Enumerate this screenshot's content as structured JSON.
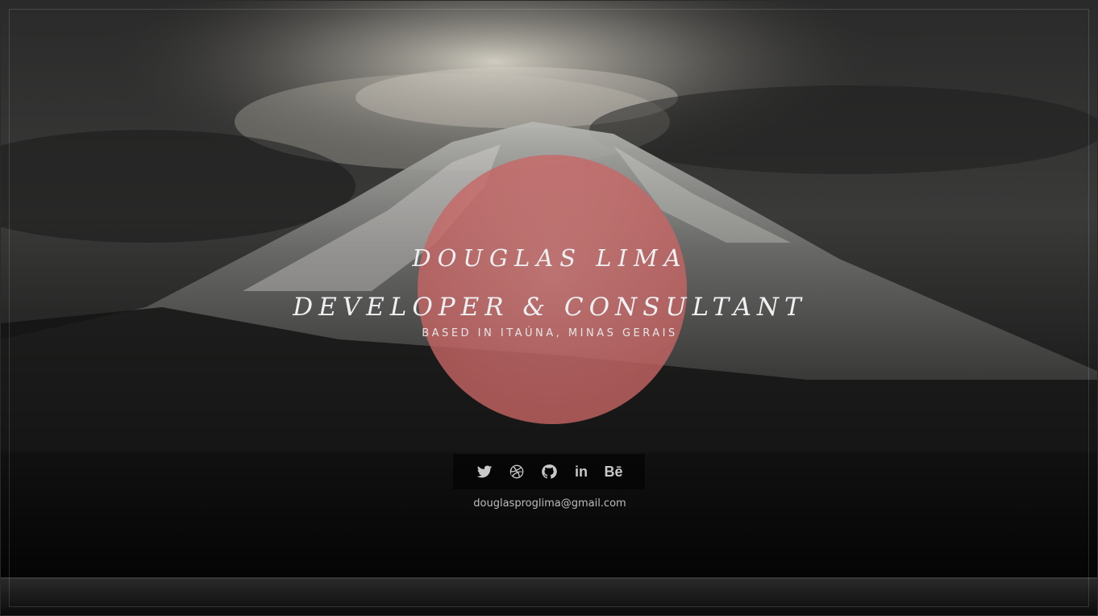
{
  "hero": {
    "name": "DOUGLAS LIMA",
    "role": "DEVELOPER & CONSULTANT",
    "location": "BASED IN ITAÚNA, MINAS GERAIS"
  },
  "social": [
    {
      "name": "twitter",
      "icon": "twitter-icon"
    },
    {
      "name": "dribbble",
      "icon": "dribbble-icon"
    },
    {
      "name": "github",
      "icon": "github-icon"
    },
    {
      "name": "linkedin",
      "icon": "linkedin-icon",
      "glyph": "in"
    },
    {
      "name": "behance",
      "icon": "behance-icon",
      "glyph": "Bē"
    }
  ],
  "contact": {
    "email": "douglasproglima@gmail.com"
  },
  "colors": {
    "sun": "#c46464",
    "text": "#eef0f2",
    "background": "#0b0b0b"
  }
}
